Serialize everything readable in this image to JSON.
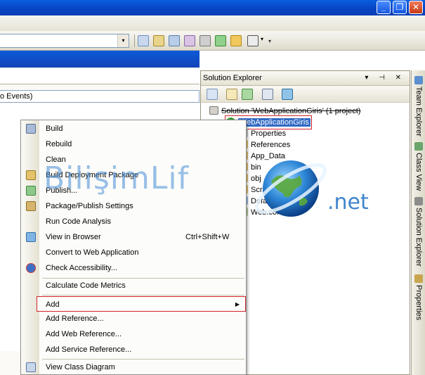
{
  "window": {
    "minimize_glyph": "_",
    "restore_glyph": "❐",
    "close_glyph": "✕"
  },
  "toolbar": {
    "combo_arrow": "▾",
    "overflow": "▾"
  },
  "document": {
    "event_combo_text": "o Events)"
  },
  "solution_explorer": {
    "title": "Solution Explorer",
    "title_controls": "▾ ⊣ ✕",
    "tree": [
      {
        "label": "Solution 'WebApplicationGiris' (1 project)"
      },
      {
        "label": "WebApplicationGiris"
      },
      {
        "label": "Properties"
      },
      {
        "label": "References"
      },
      {
        "label": "App_Data"
      },
      {
        "label": "bin"
      },
      {
        "label": "obj"
      },
      {
        "label": "Scripts"
      },
      {
        "label": "Default.aspx"
      },
      {
        "label": "Web.config"
      }
    ]
  },
  "side_tabs": [
    "Team Explorer",
    "Class View",
    "Solution Explorer",
    "Properties"
  ],
  "context_menu": {
    "items": [
      {
        "label": "Build",
        "icon": "build-icon"
      },
      {
        "label": "Rebuild"
      },
      {
        "label": "Clean"
      },
      {
        "label": "Build Deployment Package",
        "icon": "package-icon"
      },
      {
        "label": "Publish...",
        "icon": "publish-icon"
      },
      {
        "label": "Package/Publish Settings",
        "icon": "settings-icon"
      },
      {
        "label": "Run Code Analysis"
      },
      {
        "label": "View in Browser",
        "shortcut": "Ctrl+Shift+W",
        "icon": "browser-icon"
      },
      {
        "label": "Convert to Web Application"
      },
      {
        "label": "Check Accessibility...",
        "icon": "accessibility-icon"
      },
      {
        "label": "Calculate Code Metrics"
      },
      {
        "label": "Add",
        "submenu_arrow": "▶"
      },
      {
        "label": "Add Reference..."
      },
      {
        "label": "Add Web Reference..."
      },
      {
        "label": "Add Service Reference..."
      },
      {
        "label": "View Class Diagram",
        "icon": "class-diagram-icon"
      }
    ]
  },
  "watermark": {
    "brand": "BilişimLif",
    "suffix": ".net"
  },
  "colors": {
    "selection": "#316ac5",
    "highlight_border": "#d2232a",
    "titlebar": "#0848c8"
  }
}
